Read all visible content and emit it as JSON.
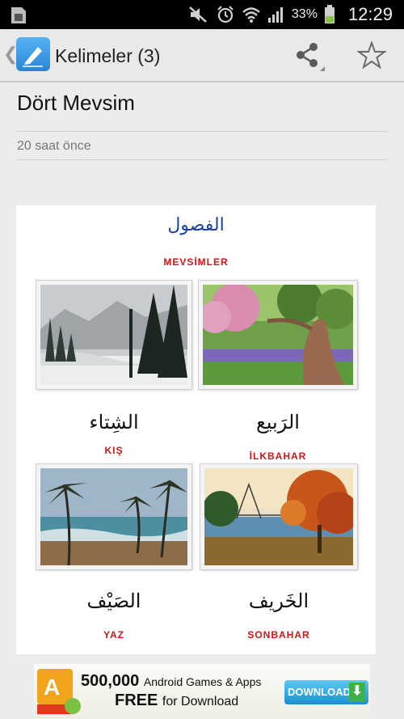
{
  "status_bar": {
    "battery": "33%",
    "time": "12:29",
    "icons": [
      "sim-icon",
      "mute-icon",
      "alarm-icon",
      "wifi-icon",
      "signal-icon",
      "battery-icon"
    ]
  },
  "action_bar": {
    "title": "Kelimeler (3)",
    "icons": [
      "back-chevron-icon",
      "app-icon",
      "share-icon",
      "star-icon"
    ]
  },
  "post": {
    "title": "Dört Mevsim",
    "time": "20 saat önce"
  },
  "poster": {
    "heading_ar": "الفصول",
    "heading": "MEVSİMLER",
    "seasons": [
      {
        "ar": "الشِتاء",
        "label": "KIŞ"
      },
      {
        "ar": "الرَبيع",
        "label": "İLKBAHAR"
      },
      {
        "ar": "الصَيْف",
        "label": "YAZ"
      },
      {
        "ar": "الخَريف",
        "label": "SONBAHAR"
      }
    ]
  },
  "ad": {
    "count": "500,000",
    "line1_rest": "Android Games & Apps",
    "free": "FREE",
    "line2_rest": "for Download",
    "download": "DOWNLOAD"
  }
}
